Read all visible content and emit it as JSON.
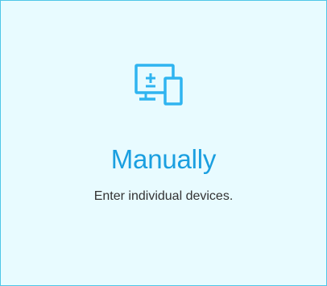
{
  "card": {
    "icon": "monitor-add-device-icon",
    "title": "Manually",
    "subtitle": "Enter individual devices."
  },
  "colors": {
    "background": "#e8fbff",
    "border": "#4fc6e8",
    "accent": "#1a9fe0",
    "icon": "#2fb4f0",
    "text": "#333333"
  }
}
